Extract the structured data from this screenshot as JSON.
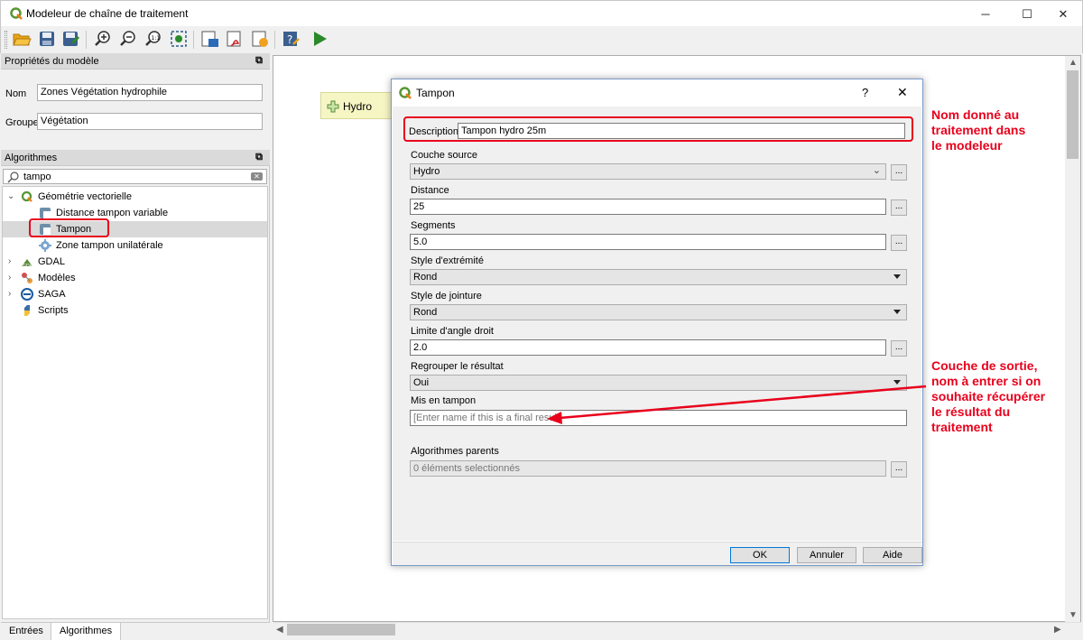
{
  "window": {
    "title": "Modeleur de chaîne de traitement",
    "controls": [
      "─",
      "☐",
      "✕"
    ]
  },
  "toolbar": {
    "buttons": [
      "open-icon",
      "save-icon",
      "save-as-icon",
      "zoom-in-icon",
      "zoom-out-icon",
      "zoom-actual-icon",
      "zoom-full-icon",
      "export-image-icon",
      "export-pdf-icon",
      "export-svg-icon",
      "edit-help-icon",
      "run-icon"
    ],
    "accent": "#2a8a2a"
  },
  "model_props": {
    "header": "Propriétés du modèle",
    "name_label": "Nom",
    "name_value": "Zones Végétation hydrophile",
    "group_label": "Groupe",
    "group_value": "Végétation"
  },
  "algorithms": {
    "header": "Algorithmes",
    "search_value": "tampo",
    "tree": [
      {
        "label": "Géométrie vectorielle",
        "expanded": true,
        "icon": "qgis-icon"
      },
      {
        "label": "Distance tampon variable",
        "icon": "buffer-icon"
      },
      {
        "label": "Tampon",
        "icon": "buffer-icon",
        "selected": true
      },
      {
        "label": "Zone tampon unilatérale",
        "icon": "gear-icon"
      },
      {
        "label": "GDAL",
        "icon": "gdal-icon"
      },
      {
        "label": "Modèles",
        "icon": "models-icon"
      },
      {
        "label": "SAGA",
        "icon": "saga-icon"
      },
      {
        "label": "Scripts",
        "icon": "python-icon"
      }
    ]
  },
  "bottom_tabs": [
    "Entrées",
    "Algorithmes"
  ],
  "canvas": {
    "input_node": "Hydro"
  },
  "dialog": {
    "title": "Tampon",
    "help": "?",
    "close": "✕",
    "description_label": "Description",
    "description_value": "Tampon hydro 25m",
    "source_label": "Couche source",
    "source_value": "Hydro",
    "distance_label": "Distance",
    "distance_value": "25",
    "segments_label": "Segments",
    "segments_value": "5.0",
    "endcap_label": "Style d'extrémité",
    "endcap_value": "Rond",
    "join_label": "Style de jointure",
    "join_value": "Rond",
    "miter_label": "Limite d'angle droit",
    "miter_value": "2.0",
    "dissolve_label": "Regrouper le résultat",
    "dissolve_value": "Oui",
    "output_label": "Mis en tampon",
    "output_placeholder": "[Enter name if this is a final result]",
    "parents_label": "Algorithmes parents",
    "parents_value": "0 éléments selectionnés",
    "dots": "...",
    "ok": "OK",
    "cancel": "Annuler",
    "help_button": "Aide"
  },
  "annotations": {
    "note1": "Nom donné au\ntraitement dans\nle modeleur",
    "note2": "Couche de sortie,\nnom à entrer si on\nsouhaite récupérer\nle résultat du\ntraitement",
    "color": "#e8001c"
  }
}
